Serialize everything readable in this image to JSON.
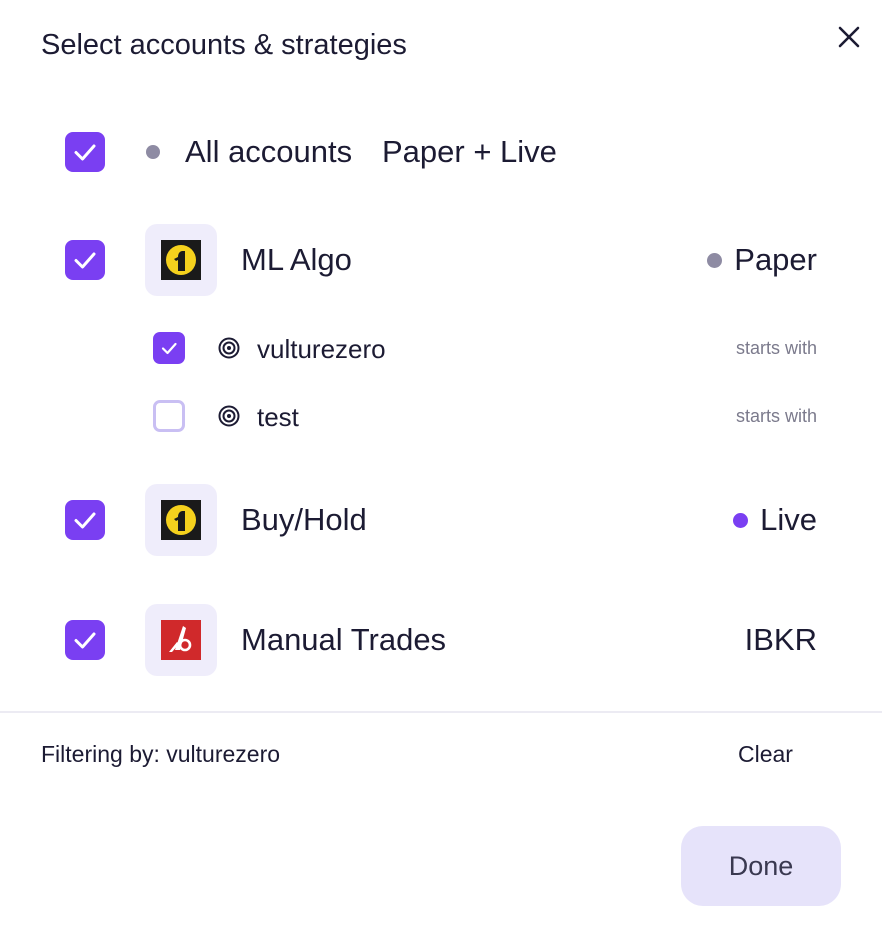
{
  "dialog": {
    "title": "Select accounts & strategies"
  },
  "all_accounts": {
    "label": "All accounts",
    "mode": "Paper + Live",
    "checked": true
  },
  "accounts": [
    {
      "name": "ML Algo",
      "status": "Paper",
      "status_color": "#8e8ba3",
      "logo_icon": "alpaca-logo-icon",
      "checked": true,
      "strategies": [
        {
          "name": "vulturezero",
          "match": "starts with",
          "checked": true
        },
        {
          "name": "test",
          "match": "starts with",
          "checked": false
        }
      ]
    },
    {
      "name": "Buy/Hold",
      "status": "Live",
      "status_color": "#7a3ff2",
      "logo_icon": "alpaca-logo-icon",
      "checked": true
    },
    {
      "name": "Manual Trades",
      "status": "IBKR",
      "logo_icon": "ibkr-logo-icon",
      "checked": true
    }
  ],
  "footer": {
    "filter_text": "Filtering by: vulturezero",
    "clear_label": "Clear",
    "done_label": "Done"
  },
  "colors": {
    "accent": "#7a3ff2",
    "dot_gray": "#8e8ba3",
    "logo_bg": "#efedfb",
    "done_bg": "#e6e3fa"
  }
}
